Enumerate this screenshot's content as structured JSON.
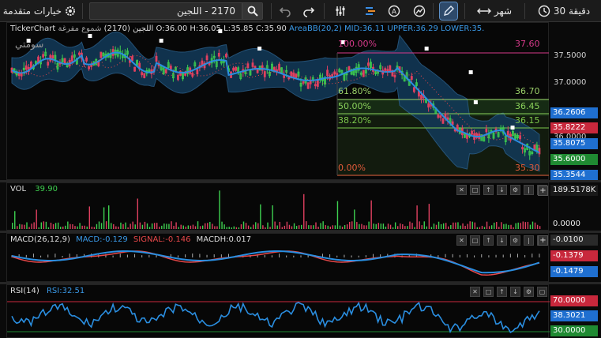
{
  "toolbar": {
    "interval": "30 دقيقة",
    "period": "شهر",
    "search_text": "2170 - اللجين",
    "advanced_options": "خيارات متقدمة"
  },
  "main": {
    "brand": "TickerChart",
    "symbol": "اللجين (2170)",
    "chart_type": "شموع مفرغة",
    "ohlc": {
      "open": "O:36.00",
      "high": "H:36.05",
      "low": "L:35.85",
      "close": "C:35.90"
    },
    "bb": {
      "name": "AreaBB(20,2)",
      "mid": "MID:36.11",
      "upper": "UPPER:36.29",
      "lower": "LOWER:35."
    },
    "watermark": "سومتي",
    "fib": [
      {
        "pct": "100.00%",
        "val": "37.60",
        "color": "#d63a8a"
      },
      {
        "pct": "61.80%",
        "val": "36.70",
        "color": "#9bd06a"
      },
      {
        "pct": "50.00%",
        "val": "36.45",
        "color": "#8ad05a"
      },
      {
        "pct": "38.20%",
        "val": "36.15",
        "color": "#7cc84c"
      },
      {
        "pct": "0.00%",
        "val": "35.30",
        "color": "#e05a3a"
      }
    ],
    "ticks": [
      "37.5000",
      "37.0000",
      "36.0000"
    ],
    "labels": [
      {
        "text": "36.2606",
        "bg": "#1f6fd0"
      },
      {
        "text": "35.8222",
        "bg": "#c8283c"
      },
      {
        "text": "35.8075",
        "bg": "#1f6fd0"
      },
      {
        "text": "35.6000",
        "bg": "#1f8a32"
      },
      {
        "text": "35.3544",
        "bg": "#1f6fd0"
      }
    ]
  },
  "vol": {
    "title": "VOL",
    "value": "39.90",
    "labels": [
      "189.5178K",
      "0.0000"
    ]
  },
  "macd": {
    "title": "MACD(26,12,9)",
    "macd": "MACD:-0.129",
    "signal": "SIGNAL:-0.146",
    "hist": "MACDH:0.017",
    "labels": [
      {
        "text": "-0.0100",
        "bg": "#2a2a2a"
      },
      {
        "text": "-0.1379",
        "bg": "#c8283c"
      },
      {
        "text": "-0.1479",
        "bg": "#1f6fd0"
      }
    ]
  },
  "rsi": {
    "title": "RSI(14)",
    "value": "RSI:32.51",
    "labels": [
      {
        "text": "70.0000",
        "bg": "#c8283c"
      },
      {
        "text": "38.3021",
        "bg": "#1f6fd0"
      },
      {
        "text": "30.0000",
        "bg": "#1f8a32"
      }
    ]
  },
  "colors": {
    "bb_line": "#2a8ee0",
    "bb_fill": "#123a5a",
    "up": "#3ed050",
    "down": "#e04060",
    "signal": "#e8484a",
    "rsi": "#2a8ee0"
  }
}
